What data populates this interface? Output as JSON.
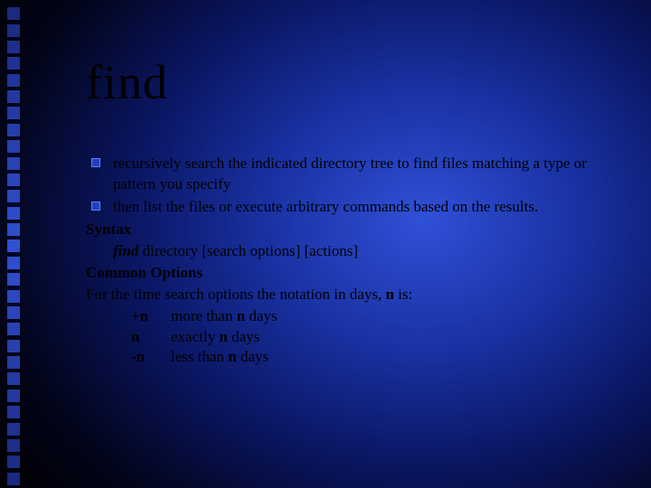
{
  "decor": {
    "count": 29,
    "color_top": "#1a2a80",
    "color_mid": "#3050d0",
    "color_bot": "#1a2a80"
  },
  "title": "find",
  "bullets": [
    "recursively search the indicated directory tree to find files matching a type or pattern you specify",
    "then list the files or execute arbitrary commands based on the results."
  ],
  "syntax_label": "Syntax",
  "syntax_cmd": "find",
  "syntax_rest": " directory [search options] [actions]",
  "common_options_label": "Common Options",
  "time_intro_pre": "For the time search options the notation in days, ",
  "time_intro_n": "n",
  "time_intro_post": " is:",
  "time_rows": [
    {
      "key": "+n",
      "pre": "more than ",
      "n": "n",
      "post": " days"
    },
    {
      "key": "n",
      "pre": "exactly ",
      "n": "n",
      "post": " days"
    },
    {
      "key": "-n",
      "pre": "less than ",
      "n": "n",
      "post": " days"
    }
  ]
}
